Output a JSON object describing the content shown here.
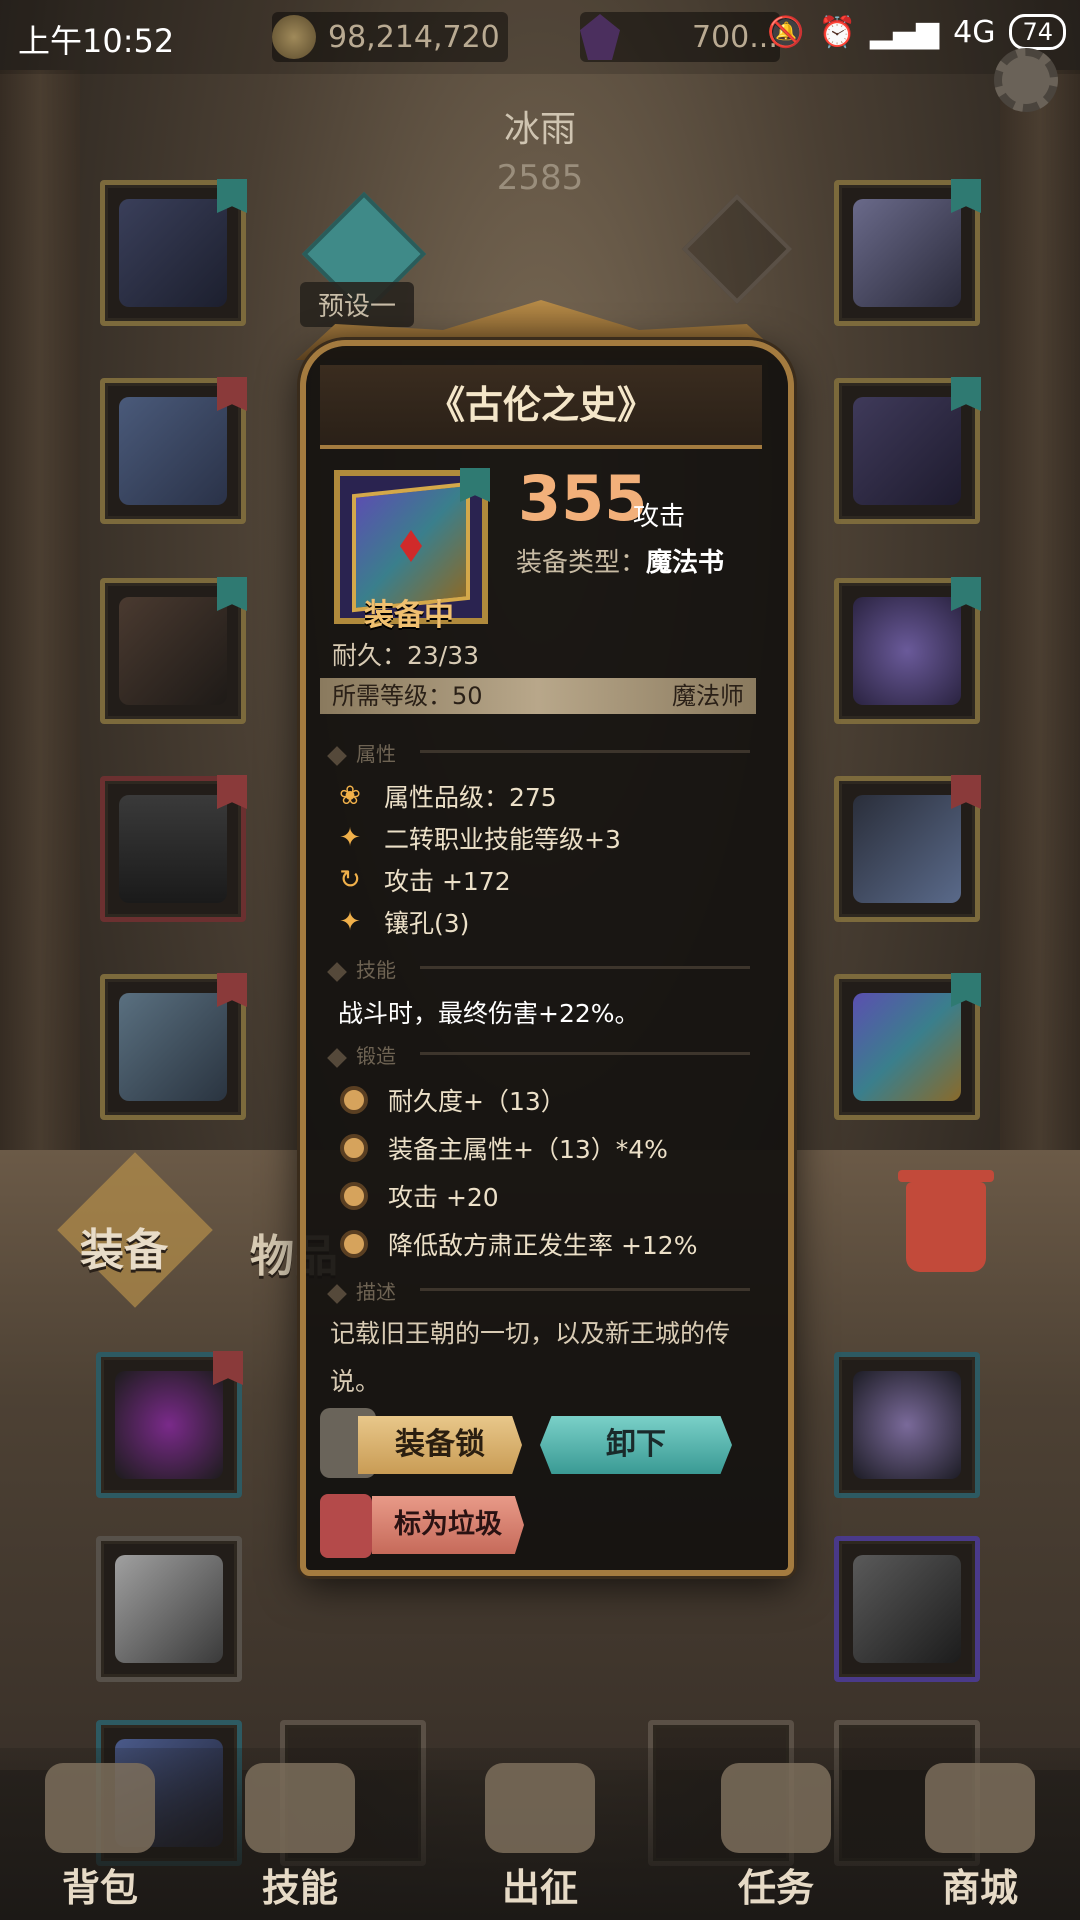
{
  "status_bar": {
    "time": "上午10:52",
    "gold": "98,214,720",
    "gems": "700...",
    "network": "4G",
    "battery": "74"
  },
  "character": {
    "name": "冰雨",
    "power": "2585",
    "preset": "预设一"
  },
  "tabs": {
    "equip": "装备",
    "items": "物品"
  },
  "item": {
    "title": "《古伦之史》",
    "attack_value": "355",
    "attack_label": "攻击",
    "type_label": "装备类型：",
    "type_value": "魔法书",
    "equipped": "装备中",
    "durability": "耐久：23/33",
    "required_level": "所需等级：50",
    "required_class": "魔法师",
    "section_attr": "属性",
    "attrs": [
      {
        "icon": "lotus-icon",
        "text": "属性品级：275"
      },
      {
        "icon": "star-icon",
        "text": "二转职业技能等级+3"
      },
      {
        "icon": "refresh-icon",
        "text": "攻击 +172"
      },
      {
        "icon": "star-icon",
        "text": "镶孔(3)"
      }
    ],
    "section_skill": "技能",
    "skill_text": "战斗时，最终伤害+22%。",
    "section_forge": "锻造",
    "forge": [
      "耐久度+（13）",
      "装备主属性+（13）*4%",
      "攻击 +20",
      "降低敌方肃正发生率 +12%"
    ],
    "section_desc": "描述",
    "description": "记载旧王朝的一切，以及新王城的传说。",
    "btn_lock": "装备锁",
    "btn_unequip": "卸下",
    "btn_junk": "标为垃圾"
  },
  "nav": [
    "背包",
    "技能",
    "出征",
    "任务",
    "商城"
  ],
  "colors": {
    "accent_gold": "#a47b3f",
    "attack_orange": "#f2b07a",
    "teal_button": "#3a9a94"
  }
}
